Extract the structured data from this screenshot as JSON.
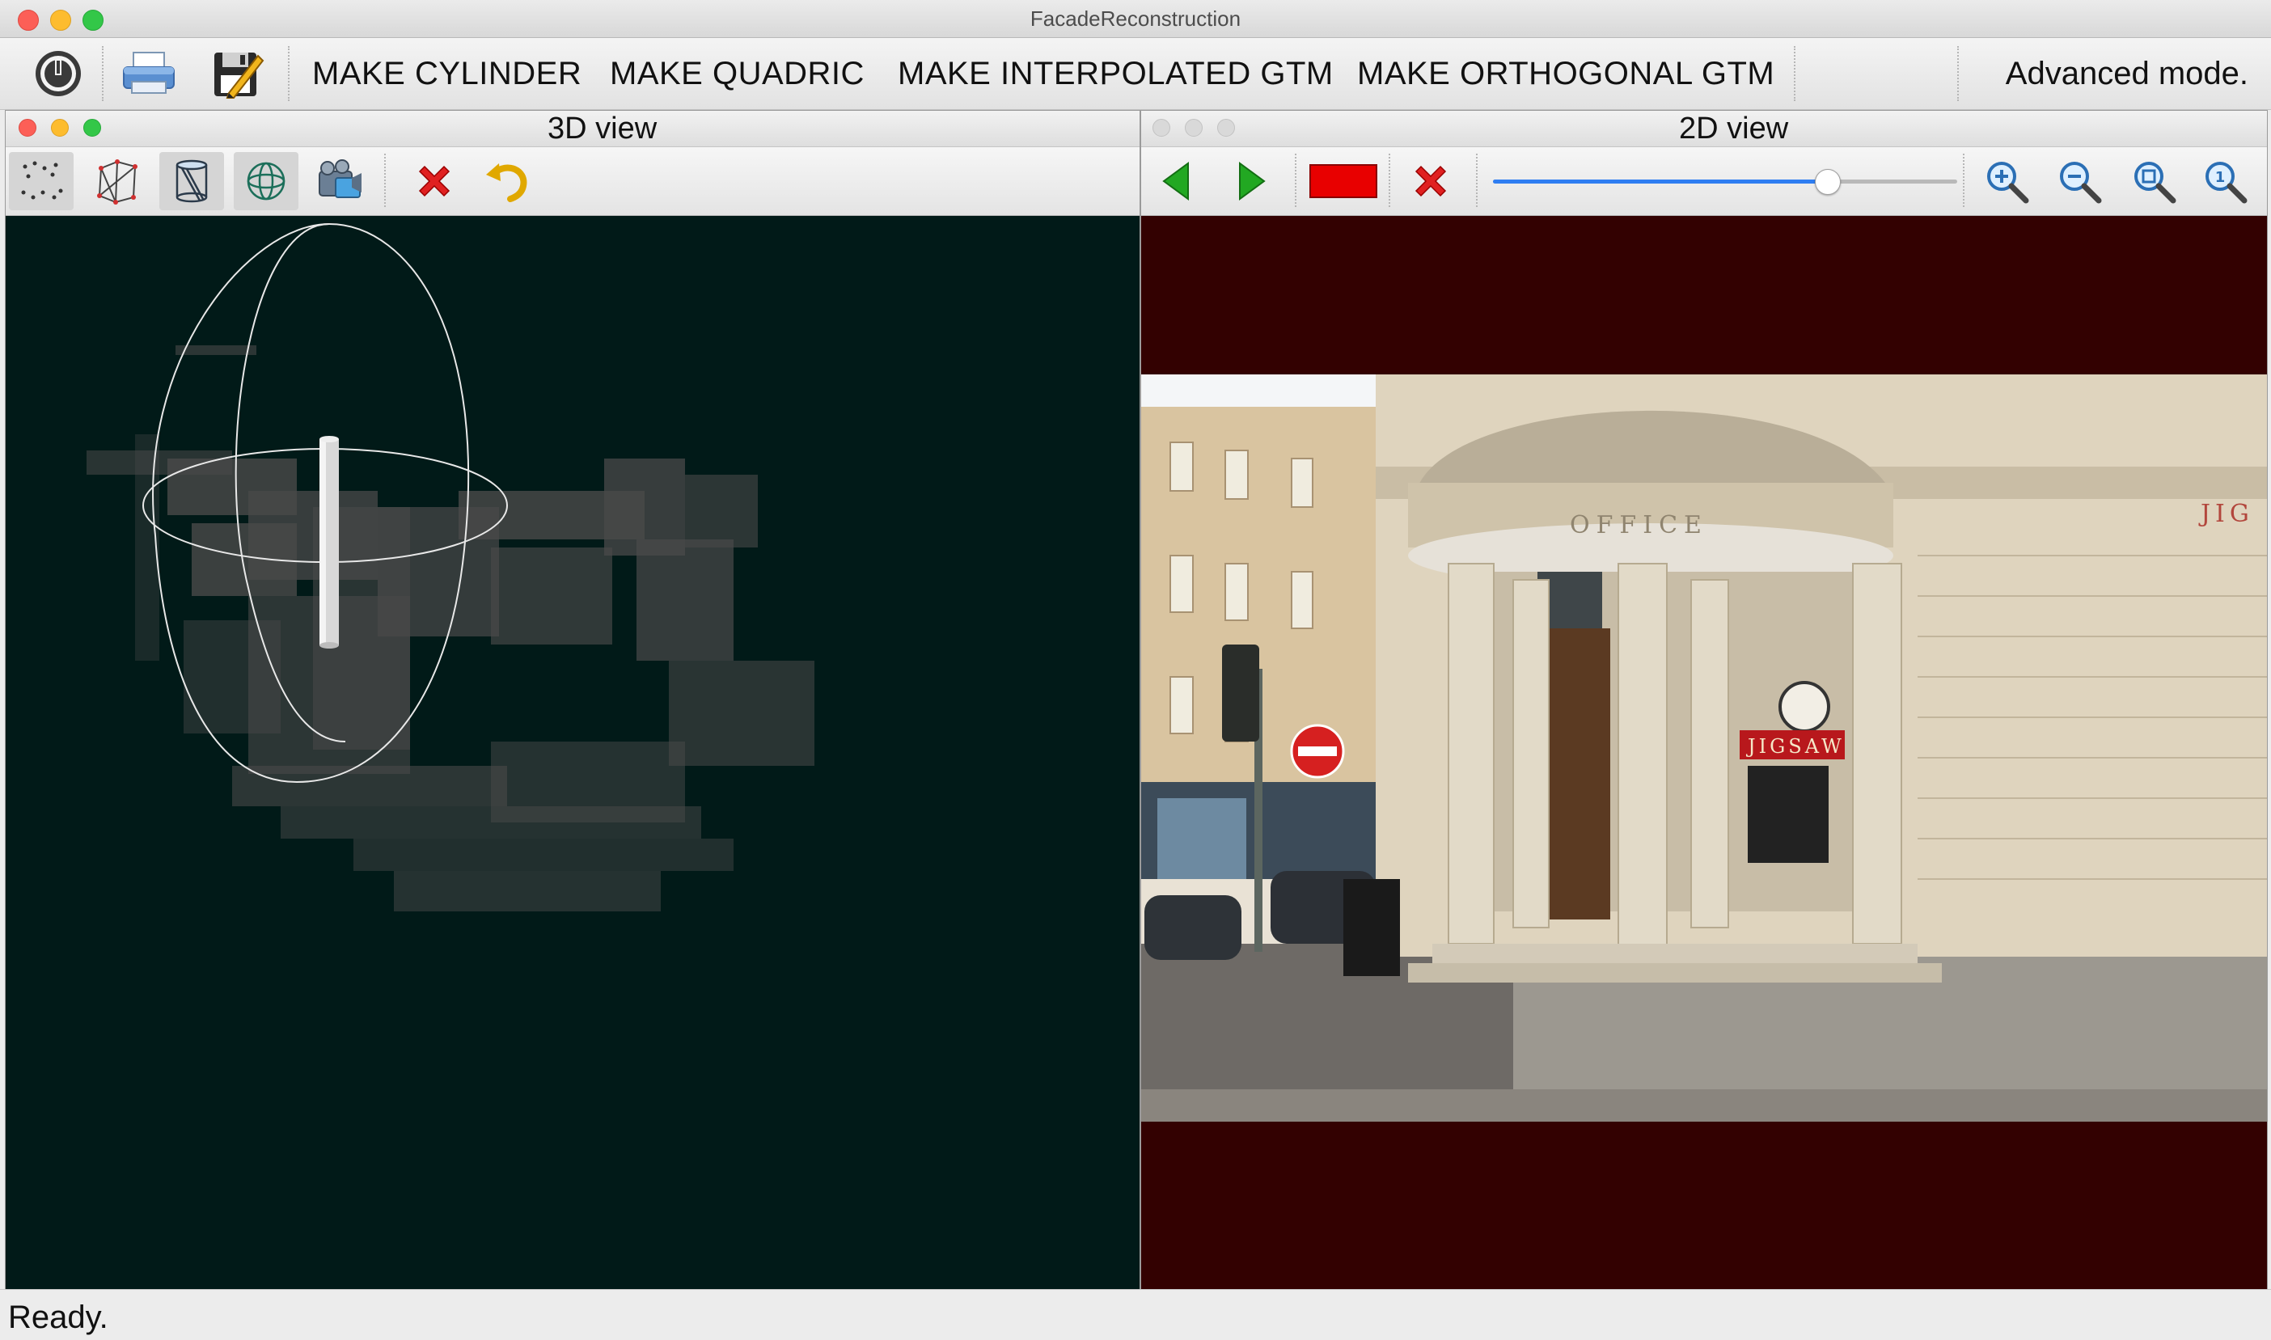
{
  "window": {
    "title": "FacadeReconstruction"
  },
  "toolbar": {
    "icons": [
      "power-icon",
      "printer-icon",
      "save-edit-icon"
    ],
    "menu": [
      {
        "label": "MAKE CYLINDER"
      },
      {
        "label": "MAKE QUADRIC"
      },
      {
        "label": "MAKE INTERPOLATED GTM"
      },
      {
        "label": "MAKE ORTHOGONAL GTM"
      }
    ],
    "mode_label": "Advanced mode."
  },
  "view3d": {
    "title": "3D view",
    "tools": [
      "point-cloud-icon",
      "mesh-icon",
      "cylinder-icon",
      "sphere-icon",
      "camera-icon",
      "delete-icon",
      "undo-icon"
    ],
    "background": "#011a18"
  },
  "view2d": {
    "title": "2D view",
    "tools": [
      "previous-arrow-icon",
      "next-arrow-icon",
      "red-rectangle-icon",
      "delete-icon",
      "zoom-in-icon",
      "zoom-out-icon",
      "zoom-fit-icon",
      "zoom-actual-icon"
    ],
    "slider_fraction": 0.72,
    "photo_texts": {
      "lintel": "OFFICE",
      "sign": "JIGSAW",
      "corner": "JIG"
    },
    "background": "#330101"
  },
  "status": {
    "text": "Ready."
  },
  "colors": {
    "accent_blue": "#2f7ef2",
    "delete_red": "#e02020",
    "arrow_green": "#22a822"
  }
}
